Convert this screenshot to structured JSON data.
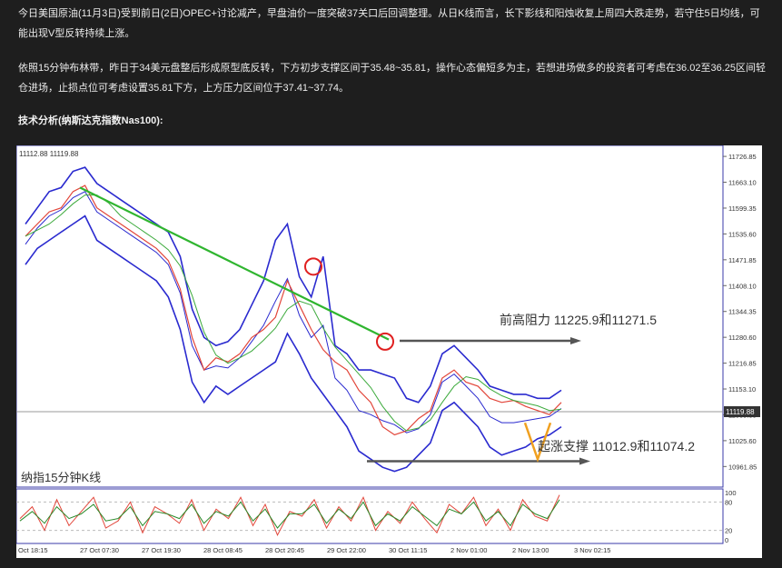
{
  "article": {
    "p1": "今日美国原油(11月3日)受到前日(2日)OPEC+讨论减产，早盘油价一度突破37关口后回调整理。从日K线而言，长下影线和阳烛收复上周四大跌走势，若守住5日均线，可能出现V型反转持续上涨。",
    "p2": "依照15分钟布林带，昨日于34美元盘整后形成原型底反转，下方初步支撑区间于35.48~35.81，操作心态偏短多为主，若想进场做多的投资者可考虑在36.02至36.25区间轻仓进场，止损点位可考虑设置35.81下方，上方压力区间位于37.41~37.74。",
    "subhead": "技术分析(纳斯达克指数Nas100):"
  },
  "chart_data": {
    "type": "line",
    "header_values": "11112.88 11119.88",
    "bottom_label": "纳指15分钟K线",
    "resistance_label": "前高阻力 11225.9和11271.5",
    "support_label": "起涨支撑 11012.9和11074.2",
    "current_price": "11119.88",
    "y_ticks": [
      "11726.85",
      "11663.10",
      "11599.35",
      "11535.60",
      "11471.85",
      "11408.10",
      "11344.35",
      "11280.60",
      "11216.85",
      "11153.10",
      "11089.35",
      "11025.60",
      "10961.85"
    ],
    "y_tick_values": [
      11726.85,
      11663.1,
      11599.35,
      11535.6,
      11471.85,
      11408.1,
      11344.35,
      11280.6,
      11216.85,
      11153.1,
      11089.35,
      11025.6,
      10961.85
    ],
    "ylim": [
      10920,
      11745
    ],
    "x_ticks": [
      "Oct 18:15",
      "27 Oct 07:30",
      "27 Oct 19:30",
      "28 Oct 08:45",
      "28 Oct 20:45",
      "29 Oct 22:00",
      "30 Oct 11:15",
      "2 Nov 01:00",
      "2 Nov 13:00",
      "3 Nov 02:15"
    ],
    "osc_ticks": [
      "100",
      "80",
      "20",
      "0"
    ],
    "osc_tick_values": [
      100,
      80,
      20,
      0
    ],
    "price_series": [
      11530,
      11560,
      11590,
      11600,
      11640,
      11655,
      11600,
      11580,
      11560,
      11540,
      11520,
      11500,
      11470,
      11400,
      11280,
      11200,
      11230,
      11220,
      11240,
      11280,
      11300,
      11330,
      11420,
      11360,
      11300,
      11250,
      11220,
      11200,
      11150,
      11120,
      11060,
      11040,
      11050,
      11080,
      11100,
      11180,
      11200,
      11170,
      11160,
      11130,
      11120,
      11125,
      11110,
      11100,
      11090,
      11120
    ],
    "upper_band": [
      11560,
      11600,
      11640,
      11650,
      11690,
      11700,
      11660,
      11640,
      11620,
      11600,
      11580,
      11560,
      11540,
      11480,
      11350,
      11280,
      11260,
      11270,
      11300,
      11360,
      11420,
      11520,
      11560,
      11430,
      11380,
      11480,
      11260,
      11240,
      11200,
      11200,
      11190,
      11180,
      11130,
      11120,
      11160,
      11240,
      11260,
      11230,
      11200,
      11160,
      11150,
      11140,
      11140,
      11130,
      11130,
      11150
    ],
    "lower_band": [
      11460,
      11500,
      11520,
      11540,
      11560,
      11580,
      11520,
      11500,
      11480,
      11460,
      11440,
      11420,
      11380,
      11300,
      11170,
      11120,
      11160,
      11140,
      11160,
      11180,
      11200,
      11220,
      11290,
      11240,
      11180,
      11140,
      11100,
      11060,
      11000,
      10980,
      10960,
      10950,
      10960,
      10990,
      11020,
      11100,
      11120,
      11090,
      11060,
      11010,
      10990,
      11000,
      11010,
      11030,
      11040,
      11060
    ],
    "trendline_from": [
      "27 Oct 07:30",
      11650
    ],
    "trendline_to": [
      "30 Oct 11:15",
      11275
    ],
    "resistance_arrow_level": 11272,
    "support_arrow_level": 10975,
    "circles": [
      [
        11455
      ],
      [
        11270
      ]
    ],
    "oscillator_k": [
      45,
      70,
      20,
      85,
      30,
      60,
      90,
      25,
      40,
      80,
      15,
      70,
      55,
      35,
      85,
      20,
      65,
      45,
      90,
      30,
      75,
      10,
      60,
      50,
      85,
      25,
      70,
      40,
      90,
      20,
      60,
      35,
      80,
      45,
      15,
      75,
      55,
      90,
      30,
      65,
      20,
      85,
      50,
      40,
      95
    ],
    "oscillator_d": [
      40,
      60,
      35,
      70,
      45,
      55,
      75,
      40,
      45,
      70,
      30,
      60,
      55,
      45,
      75,
      35,
      60,
      50,
      80,
      40,
      65,
      25,
      55,
      55,
      75,
      35,
      65,
      45,
      80,
      30,
      55,
      40,
      70,
      50,
      30,
      65,
      55,
      80,
      40,
      60,
      30,
      75,
      55,
      45,
      85
    ]
  }
}
